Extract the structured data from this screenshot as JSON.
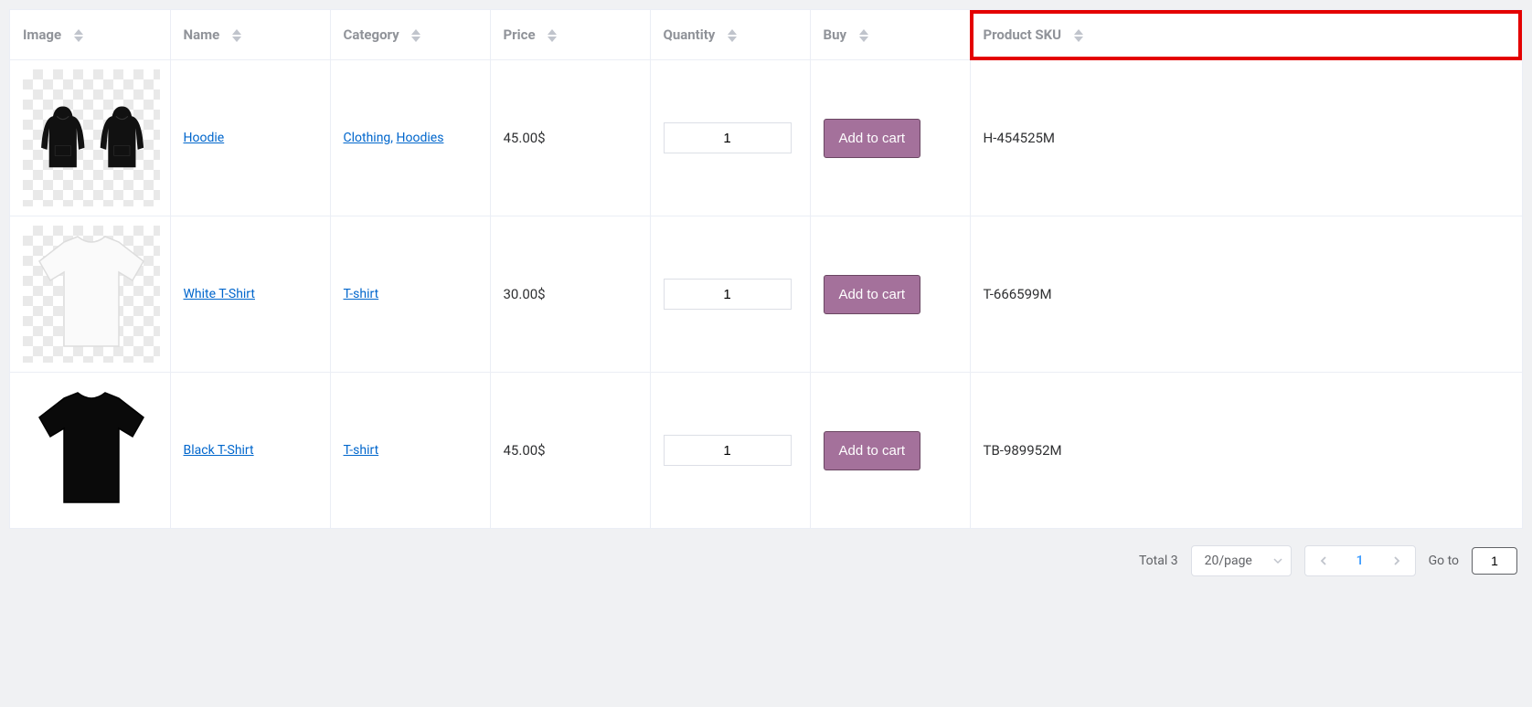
{
  "columns": {
    "image": "Image",
    "name": "Name",
    "category": "Category",
    "price": "Price",
    "quantity": "Quantity",
    "buy": "Buy",
    "sku": "Product SKU"
  },
  "buy_label": "Add to cart",
  "rows": [
    {
      "image": "hoodie",
      "name": "Hoodie",
      "categories": [
        "Clothing",
        "Hoodies"
      ],
      "price": "45.00$",
      "quantity": "1",
      "sku": "H-454525M"
    },
    {
      "image": "white-tshirt",
      "name": "White T-Shirt",
      "categories": [
        "T-shirt"
      ],
      "price": "30.00$",
      "quantity": "1",
      "sku": "T-666599M"
    },
    {
      "image": "black-tshirt",
      "name": "Black T-Shirt",
      "categories": [
        "T-shirt"
      ],
      "price": "45.00$",
      "quantity": "1",
      "sku": "TB-989952M"
    }
  ],
  "pagination": {
    "total_label": "Total 3",
    "page_size": "20/page",
    "current_page": "1",
    "goto_label": "Go to",
    "goto_value": "1"
  }
}
